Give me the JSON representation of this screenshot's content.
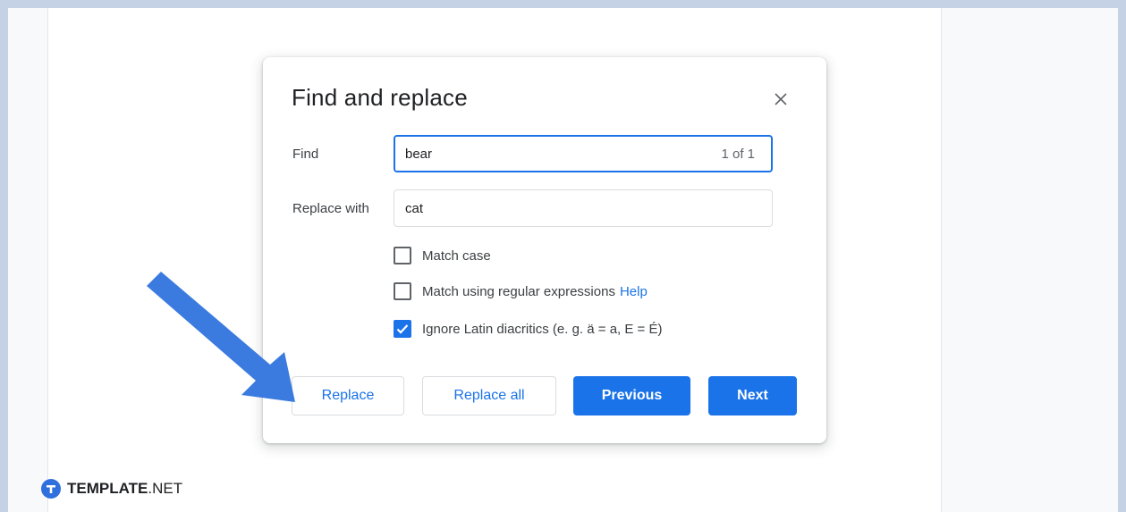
{
  "dialog": {
    "title": "Find and replace",
    "close_icon": "close-icon"
  },
  "find": {
    "label": "Find",
    "value": "bear",
    "count": "1 of 1"
  },
  "replace": {
    "label": "Replace with",
    "value": "cat"
  },
  "options": {
    "match_case": {
      "label": "Match case",
      "checked": false
    },
    "regex": {
      "label": "Match using regular expressions",
      "help": "Help",
      "checked": false
    },
    "diacritics": {
      "label": "Ignore Latin diacritics (e. g. ä = a, E = É)",
      "checked": true
    }
  },
  "buttons": {
    "replace": "Replace",
    "replace_all": "Replace all",
    "previous": "Previous",
    "next": "Next"
  },
  "watermark": {
    "bold": "TEMPLATE",
    "suffix": ".NET"
  },
  "colors": {
    "accent": "#1a73e8",
    "annotation_arrow": "#3b7be0",
    "frame": "#c5d2e6"
  }
}
